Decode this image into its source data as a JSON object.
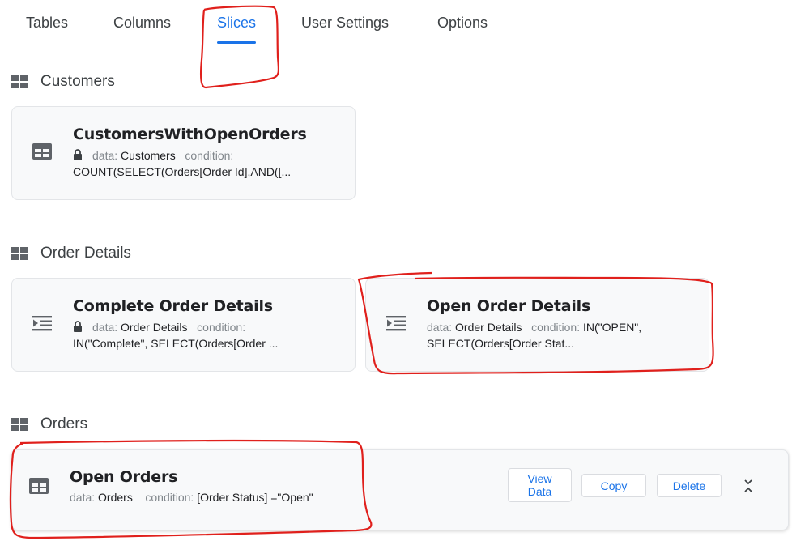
{
  "tabs": [
    {
      "label": "Tables"
    },
    {
      "label": "Columns"
    },
    {
      "label": "Slices"
    },
    {
      "label": "User Settings"
    },
    {
      "label": "Options"
    }
  ],
  "active_tab": "Slices",
  "sections": [
    {
      "title": "Customers",
      "slices": [
        {
          "name": "CustomersWithOpenOrders",
          "locked": true,
          "data_label": "data:",
          "data_value": "Customers",
          "condition_label": "condition:",
          "condition_value": "COUNT(SELECT(Orders[Order Id],AND([..."
        }
      ]
    },
    {
      "title": "Order Details",
      "slices": [
        {
          "name": "Complete Order Details",
          "locked": true,
          "data_label": "data:",
          "data_value": "Order Details",
          "condition_label": "condition:",
          "condition_value": "IN(\"Complete\", SELECT(Orders[Order ..."
        },
        {
          "name": "Open Order Details",
          "locked": false,
          "data_label": "data:",
          "data_value": "Order Details",
          "condition_label": "condition:",
          "condition_value": "IN(\"OPEN\",",
          "condition_value_2": "SELECT(Orders[Order Stat..."
        }
      ]
    },
    {
      "title": "Orders",
      "slices": [
        {
          "name": "Open Orders",
          "locked": false,
          "data_label": "data:",
          "data_value": "Orders",
          "condition_label": "condition:",
          "condition_value": "[Order Status] =\"Open\""
        }
      ]
    }
  ],
  "actions": {
    "view_data_line1": "View",
    "view_data_line2": "Data",
    "copy": "Copy",
    "delete": "Delete"
  },
  "colors": {
    "accent": "#1a73e8",
    "annotation": "#e0201c"
  },
  "icons": {
    "section": "grid-icon",
    "table_slice": "table-icon",
    "detail_slice": "indent-list-icon",
    "locked": "lock-icon",
    "collapse": "collapse-chevrons-icon"
  }
}
